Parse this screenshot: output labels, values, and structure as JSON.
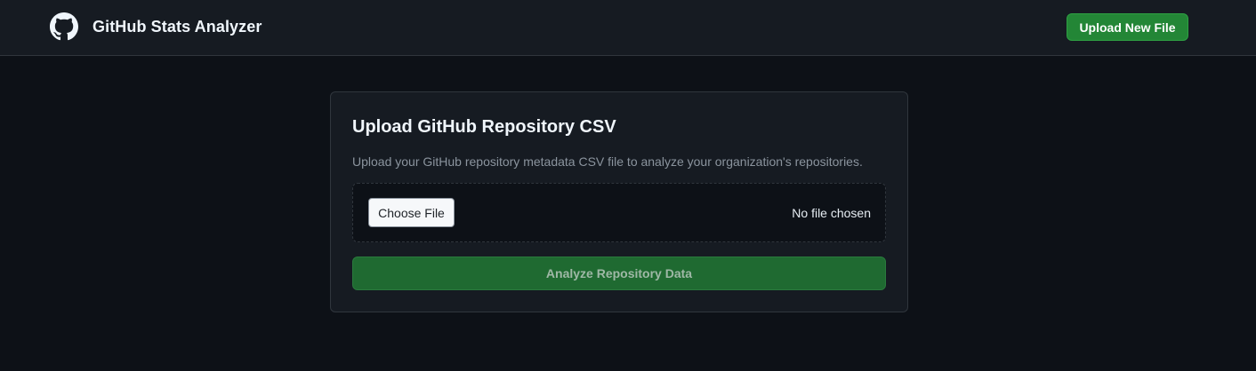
{
  "header": {
    "app_title": "GitHub Stats Analyzer",
    "logo_icon": "github-icon",
    "upload_new_label": "Upload New File"
  },
  "upload_card": {
    "title": "Upload GitHub Repository CSV",
    "description": "Upload your GitHub repository metadata CSV file to analyze your organization's repositories.",
    "choose_file_label": "Choose File",
    "file_status": "No file chosen",
    "analyze_label": "Analyze Repository Data"
  },
  "colors": {
    "background": "#0d1117",
    "header_background": "#161b22",
    "primary_green": "#238636",
    "disabled_green": "#1f6a31",
    "muted_text": "#8b949e"
  }
}
